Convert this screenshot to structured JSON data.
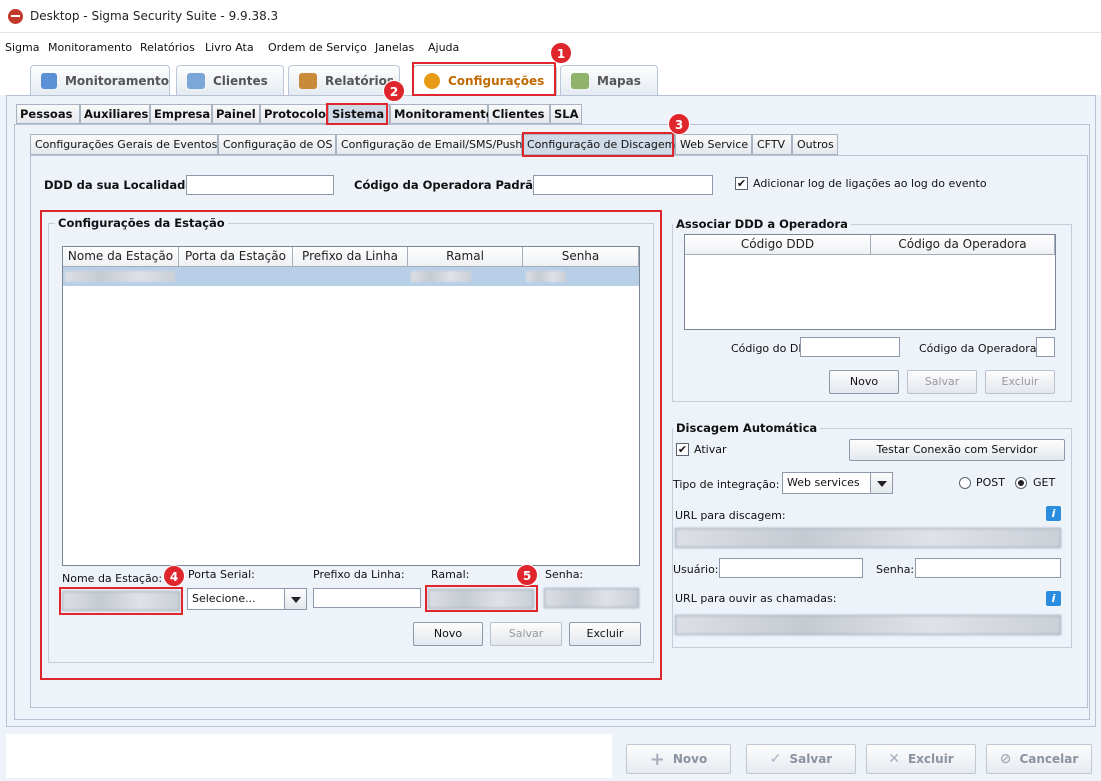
{
  "window": {
    "title": "Desktop - Sigma Security Suite - 9.9.38.3"
  },
  "menu": [
    "Sigma",
    "Monitoramento",
    "Relatórios",
    "Livro Ata",
    "Ordem de Serviço",
    "Janelas",
    "Ajuda"
  ],
  "main_tabs": [
    "Monitoramento",
    "Clientes",
    "Relatórios",
    "Configurações",
    "Mapas"
  ],
  "sub_tabs": [
    "Pessoas",
    "Auxiliares",
    "Empresa",
    "Painel",
    "Protocolo",
    "Sistema",
    "Monitoramento",
    "Clientes",
    "SLA"
  ],
  "third_tabs": [
    "Configurações Gerais de Eventos",
    "Configuração de OS",
    "Configuração de  Email/SMS/Push",
    "Configuração de Discagem",
    "Web Service",
    "CFTV",
    "Outros"
  ],
  "top": {
    "ddd_label": "DDD da sua Localidade:",
    "operadora_label": "Código da Operadora Padrão:",
    "log_label": "Adicionar log de ligações ao log do evento",
    "log_checked": true
  },
  "estacao": {
    "title": "Configurações da Estação",
    "columns": [
      "Nome da Estação",
      "Porta da Estação",
      "Prefixo da Linha",
      "Ramal",
      "Senha"
    ],
    "labels": {
      "nome": "Nome da Estação:",
      "porta": "Porta Serial:",
      "prefixo": "Prefixo da Linha:",
      "ramal": "Ramal:",
      "senha": "Senha:"
    },
    "porta_value": "Selecione...",
    "buttons": {
      "novo": "Novo",
      "salvar": "Salvar",
      "excluir": "Excluir"
    }
  },
  "ddd_op": {
    "title": "Associar DDD a Operadora",
    "columns": [
      "Código DDD",
      "Código da Operadora"
    ],
    "ddd_label": "Código do DDD:",
    "op_label": "Código da Operadora:",
    "buttons": {
      "novo": "Novo",
      "salvar": "Salvar",
      "excluir": "Excluir"
    }
  },
  "discagem": {
    "title": "Discagem Automática",
    "ativar": "Ativar",
    "ativar_checked": true,
    "testar": "Testar Conexão com Servidor",
    "tipo_label": "Tipo de integração:",
    "tipo_value": "Web services",
    "post": "POST",
    "get": "GET",
    "method_selected": "GET",
    "url_label": "URL para discagem:",
    "usuario_label": "Usuário:",
    "senha_label": "Senha:",
    "ouvir_label": "URL para ouvir as chamadas:",
    "info_icon": "i"
  },
  "footer": {
    "novo": "Novo",
    "salvar": "Salvar",
    "excluir": "Excluir",
    "cancelar": "Cancelar"
  },
  "badges": [
    "1",
    "2",
    "3",
    "4",
    "5"
  ]
}
